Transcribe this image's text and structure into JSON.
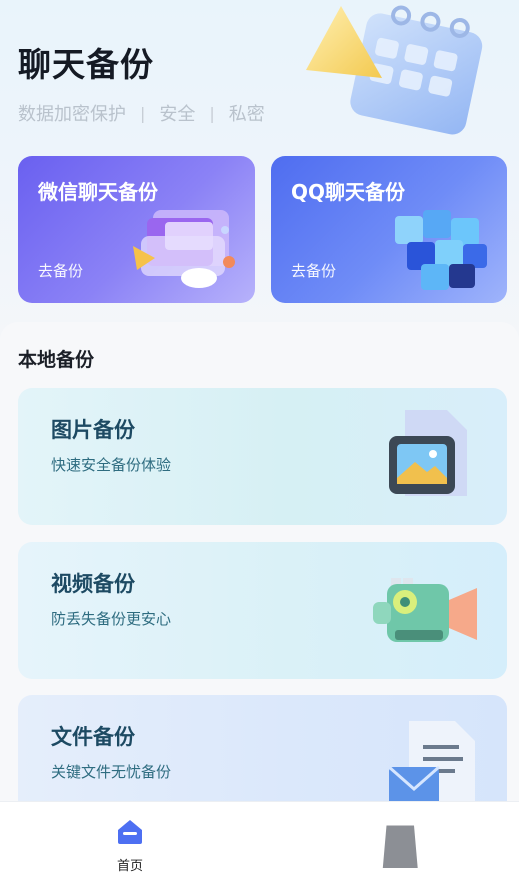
{
  "header": {
    "title": "聊天备份",
    "subtitle_items": [
      "数据加密保护",
      "安全",
      "私密"
    ],
    "separator": "|"
  },
  "cards": [
    {
      "title": "微信聊天备份",
      "link": "去备份",
      "icon": "folder-icon"
    },
    {
      "title": "QQ聊天备份",
      "link": "去备份",
      "icon": "cube-icon"
    }
  ],
  "local": {
    "section_title": "本地备份",
    "items": [
      {
        "title": "图片备份",
        "desc": "快速安全备份体验",
        "icon": "image-file-icon"
      },
      {
        "title": "视频备份",
        "desc": "防丢失备份更安心",
        "icon": "video-camera-icon"
      },
      {
        "title": "文件备份",
        "desc": "关键文件无忧备份",
        "icon": "document-icon"
      }
    ]
  },
  "tabbar": {
    "tabs": [
      {
        "label": "首页",
        "icon": "home-icon",
        "active": true
      },
      {
        "label": "",
        "icon": "profile-icon",
        "active": false
      }
    ]
  },
  "colors": {
    "wechat_card": "#7a71f3",
    "qq_card": "#5f7ef4",
    "row_title": "#1d4a63",
    "row_desc": "#2e6c80",
    "home_icon": "#4d6ff2"
  }
}
